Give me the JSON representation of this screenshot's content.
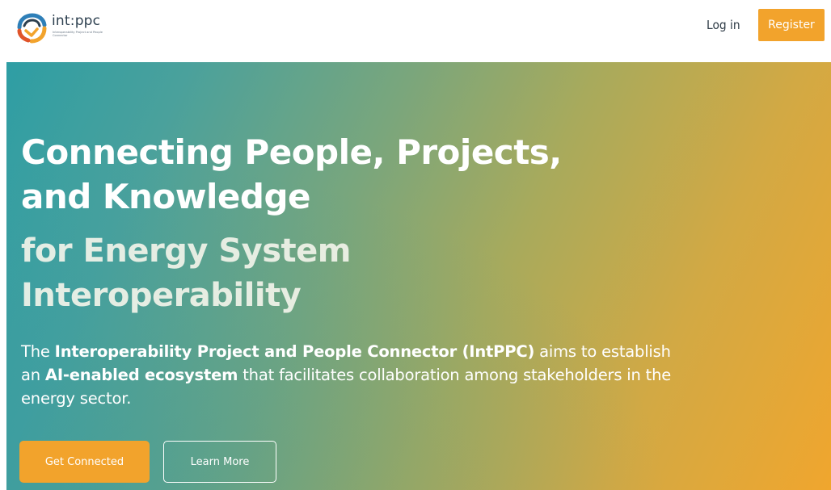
{
  "brand": {
    "name": "int:ppc",
    "tagline": "Interoperability Project and People Connector",
    "colors": {
      "orange": "#f2a32c",
      "teal": "#2e9ea4",
      "navy": "#2c3f4f"
    }
  },
  "nav": {
    "login_label": "Log in",
    "register_label": "Register"
  },
  "hero": {
    "title_line1": "Connecting People, Projects,",
    "title_line2": "and Knowledge",
    "subtitle_line1": "for Energy System",
    "subtitle_line2": "Interoperability",
    "description": {
      "p1": "The ",
      "b1": "Interoperability Project and People Connector (IntPPC)",
      "p2": " aims to establish an ",
      "b2": "AI-enabled ecosystem",
      "p3": " that facilitates collaboration among stakeholders in the energy sector."
    },
    "primary_cta": "Get Connected",
    "secondary_cta": "Learn More"
  },
  "icons": {
    "logo": "intppc-logo-icon"
  }
}
